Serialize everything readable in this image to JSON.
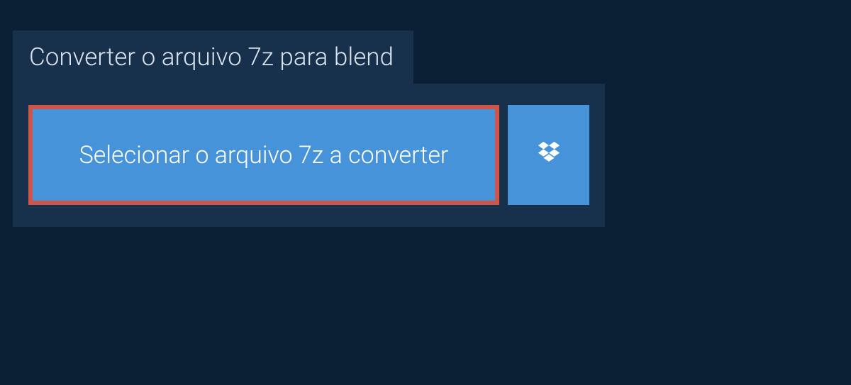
{
  "header": {
    "tab_label": "Converter o arquivo 7z para blend"
  },
  "actions": {
    "select_file_label": "Selecionar o arquivo 7z a converter"
  },
  "colors": {
    "background": "#0c2035",
    "panel": "#17304c",
    "button_primary": "#4793d9",
    "button_highlight_border": "#d05549",
    "text_light": "#d9e2ec"
  }
}
